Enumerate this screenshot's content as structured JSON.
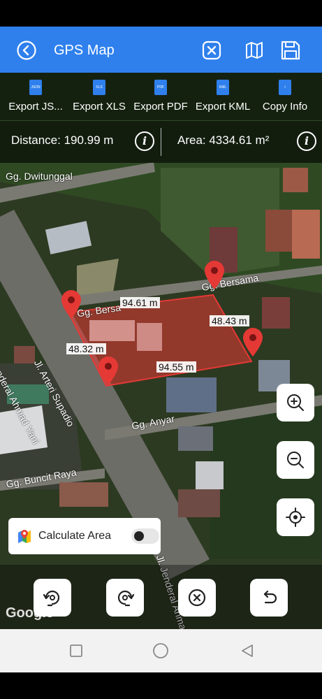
{
  "app_bar": {
    "title": "GPS Map"
  },
  "exports": [
    {
      "label": "Export JS...",
      "file_tag": "JSON"
    },
    {
      "label": "Export XLS",
      "file_tag": "XLS"
    },
    {
      "label": "Export PDF",
      "file_tag": "PDF"
    },
    {
      "label": "Export KML",
      "file_tag": "KML"
    },
    {
      "label": "Copy Info",
      "file_tag": "i"
    }
  ],
  "measure": {
    "distance": "Distance: 190.99 m",
    "area": "Area: 4334.61 m²"
  },
  "map": {
    "street_labels": [
      "Gg. Dwitunggal",
      "Jenderal Ahmad Yani",
      "Jl. Arteri Supadio",
      "Gg. Bersama",
      "Gg. Bersa",
      "Gg. Anyar",
      "Gg. Buncit Raya",
      "Jl. Jenderal Ahmad"
    ],
    "segment_labels": [
      "94.61 m",
      "48.43 m",
      "94.55 m",
      "48.32 m"
    ],
    "attribution": "Google"
  },
  "calculate_area": {
    "label": "Calculate Area",
    "enabled": false
  },
  "colors": {
    "app_bar": "#2f80ed",
    "polygon": "#e53935",
    "marker": "#e53935"
  },
  "icons": {
    "back": "chevron-left-circle-icon",
    "close": "close-icon",
    "map": "map-icon",
    "save": "save-icon",
    "zoom_in": "zoom-in-icon",
    "zoom_out": "zoom-out-icon",
    "locate": "crosshair-icon",
    "rotate_left": "rotate-left-icon",
    "rotate_right": "rotate-right-icon",
    "clear": "clear-circle-icon",
    "undo": "undo-icon"
  }
}
